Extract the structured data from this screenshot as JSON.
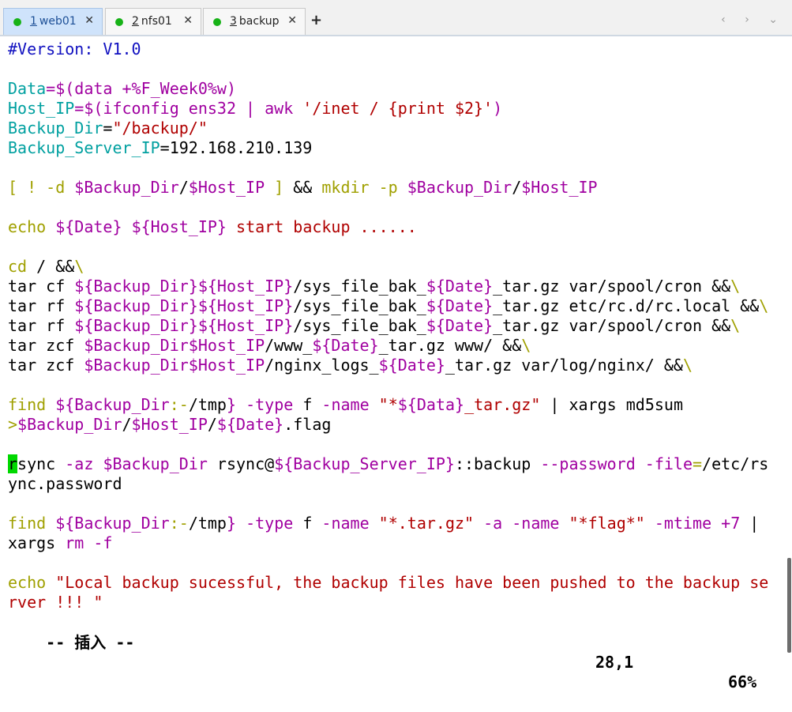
{
  "tabs": [
    {
      "num": "1",
      "name": "web01",
      "close": "✕"
    },
    {
      "num": "2",
      "name": "nfs01",
      "close": "✕"
    },
    {
      "num": "3",
      "name": "backup",
      "close": "✕"
    }
  ],
  "new_tab": "+",
  "nav_arrows": "‹ ›",
  "dropdown": "⌄",
  "status_bar": {
    "mode": "-- 插入 --",
    "position": "28,1",
    "percent": "66%"
  },
  "colors": {
    "keyword": "#0000c0",
    "variable": "#00a0a0",
    "purple": "#a000a0",
    "string": "#b00000",
    "olive": "#a0a000",
    "cursor": "#00d800",
    "active_tab": "#cfe3fb"
  },
  "terminal_lines": [
    [
      [
        "#Version: V1.0",
        "#1010c0"
      ]
    ],
    [],
    [
      [
        "Data",
        "#00a0a0"
      ],
      [
        "=$(data +%F_Week0%w)",
        "#a000a0"
      ]
    ],
    [
      [
        "Host_IP",
        "#00a0a0"
      ],
      [
        "=$(ifconfig ens32 | awk ",
        "#a000a0"
      ],
      [
        "'/inet / {print $2}'",
        "#b00000"
      ],
      [
        ")",
        "#a000a0"
      ]
    ],
    [
      [
        "Backup_Dir",
        "#00a0a0"
      ],
      [
        "=",
        "#000000"
      ],
      [
        "\"/backup/\"",
        "#b00000"
      ]
    ],
    [
      [
        "Backup_Server_IP",
        "#00a0a0"
      ],
      [
        "=192.168.210.139",
        "#000000"
      ]
    ],
    [],
    [
      [
        "[ ! -d ",
        "#a0a000"
      ],
      [
        "$Backup_Dir",
        "#a000a0"
      ],
      [
        "/",
        "#000000"
      ],
      [
        "$Host_IP",
        "#a000a0"
      ],
      [
        " ] ",
        "#a0a000"
      ],
      [
        "&& ",
        "#000000"
      ],
      [
        "mkdir -p ",
        "#a0a000"
      ],
      [
        "$Backup_Dir",
        "#a000a0"
      ],
      [
        "/",
        "#000000"
      ],
      [
        "$Host_IP",
        "#a000a0"
      ]
    ],
    [],
    [
      [
        "echo ",
        "#a0a000"
      ],
      [
        "${Date}",
        "#a000a0"
      ],
      [
        " ",
        "#000000"
      ],
      [
        "${Host_IP}",
        "#a000a0"
      ],
      [
        " start backup ......",
        "#b00000"
      ]
    ],
    [],
    [
      [
        "cd",
        "#a0a000"
      ],
      [
        " / &&",
        "#000000"
      ],
      [
        "\\",
        "#a0a000"
      ]
    ],
    [
      [
        "tar cf ",
        "#000000"
      ],
      [
        "${Backup_Dir}${Host_IP}",
        "#a000a0"
      ],
      [
        "/sys_file_bak_",
        "#000000"
      ],
      [
        "${Date}",
        "#a000a0"
      ],
      [
        "_tar.gz var/spool/cron &&",
        "#000000"
      ],
      [
        "\\",
        "#a0a000"
      ]
    ],
    [
      [
        "tar rf ",
        "#000000"
      ],
      [
        "${Backup_Dir}${Host_IP}",
        "#a000a0"
      ],
      [
        "/sys_file_bak_",
        "#000000"
      ],
      [
        "${Date}",
        "#a000a0"
      ],
      [
        "_tar.gz etc/rc.d/rc.local &&",
        "#000000"
      ],
      [
        "\\",
        "#a0a000"
      ]
    ],
    [
      [
        "tar rf ",
        "#000000"
      ],
      [
        "${Backup_Dir}${Host_IP}",
        "#a000a0"
      ],
      [
        "/sys_file_bak_",
        "#000000"
      ],
      [
        "${Date}",
        "#a000a0"
      ],
      [
        "_tar.gz var/spool/cron &&",
        "#000000"
      ],
      [
        "\\",
        "#a0a000"
      ]
    ],
    [
      [
        "tar zcf ",
        "#000000"
      ],
      [
        "$Backup_Dir$Host_IP",
        "#a000a0"
      ],
      [
        "/www_",
        "#000000"
      ],
      [
        "${Date}",
        "#a000a0"
      ],
      [
        "_tar.gz www/ &&",
        "#000000"
      ],
      [
        "\\",
        "#a0a000"
      ]
    ],
    [
      [
        "tar zcf ",
        "#000000"
      ],
      [
        "$Backup_Dir$Host_IP",
        "#a000a0"
      ],
      [
        "/nginx_logs_",
        "#000000"
      ],
      [
        "${Date}",
        "#a000a0"
      ],
      [
        "_tar.gz var/log/nginx/ &&",
        "#000000"
      ],
      [
        "\\",
        "#a0a000"
      ]
    ],
    [],
    [
      [
        "find ",
        "#a0a000"
      ],
      [
        "${Backup_Dir",
        "#a000a0"
      ],
      [
        ":-",
        "#a0a000"
      ],
      [
        "/tmp",
        "#000000"
      ],
      [
        "}",
        "#a000a0"
      ],
      [
        " -type ",
        "#a000a0"
      ],
      [
        "f",
        "#000000"
      ],
      [
        " -name ",
        "#a000a0"
      ],
      [
        "\"*",
        "#b00000"
      ],
      [
        "${Data}",
        "#a000a0"
      ],
      [
        "_tar.gz\"",
        "#b00000"
      ],
      [
        " | xargs md5sum",
        "#000000"
      ]
    ],
    [
      [
        ">",
        "#a0a000"
      ],
      [
        "$Backup_Dir",
        "#a000a0"
      ],
      [
        "/",
        "#000000"
      ],
      [
        "$Host_IP",
        "#a000a0"
      ],
      [
        "/",
        "#000000"
      ],
      [
        "${Date}",
        "#a000a0"
      ],
      [
        ".flag",
        "#000000"
      ]
    ],
    [],
    [
      [
        "r",
        "cursor"
      ],
      [
        "sync",
        "#000000"
      ],
      [
        " -az ",
        "#a000a0"
      ],
      [
        "$Backup_Dir",
        "#a000a0"
      ],
      [
        " rsync@",
        "#000000"
      ],
      [
        "${Backup_Server_IP}",
        "#a000a0"
      ],
      [
        "::backup ",
        "#000000"
      ],
      [
        "--password -file",
        "#a000a0"
      ],
      [
        "=",
        "#a0a000"
      ],
      [
        "/etc/rs",
        "#000000"
      ]
    ],
    [
      [
        "ync.password",
        "#000000"
      ]
    ],
    [],
    [
      [
        "find ",
        "#a0a000"
      ],
      [
        "${Backup_Dir",
        "#a000a0"
      ],
      [
        ":-",
        "#a0a000"
      ],
      [
        "/tmp",
        "#000000"
      ],
      [
        "}",
        "#a000a0"
      ],
      [
        " -type ",
        "#a000a0"
      ],
      [
        "f",
        "#000000"
      ],
      [
        " -name ",
        "#a000a0"
      ],
      [
        "\"*.tar.gz\"",
        "#b00000"
      ],
      [
        " -a -name ",
        "#a000a0"
      ],
      [
        "\"*flag*\"",
        "#b00000"
      ],
      [
        " -mtime +7",
        "#a000a0"
      ],
      [
        " |",
        "#000000"
      ]
    ],
    [
      [
        "xargs ",
        "#000000"
      ],
      [
        "rm -f",
        "#a000a0"
      ]
    ],
    [],
    [
      [
        "echo ",
        "#a0a000"
      ],
      [
        "\"Local backup sucessful, the backup files have been pushed to the backup se",
        "#b00000"
      ]
    ],
    [
      [
        "rver !!! \"",
        "#b00000"
      ]
    ]
  ]
}
